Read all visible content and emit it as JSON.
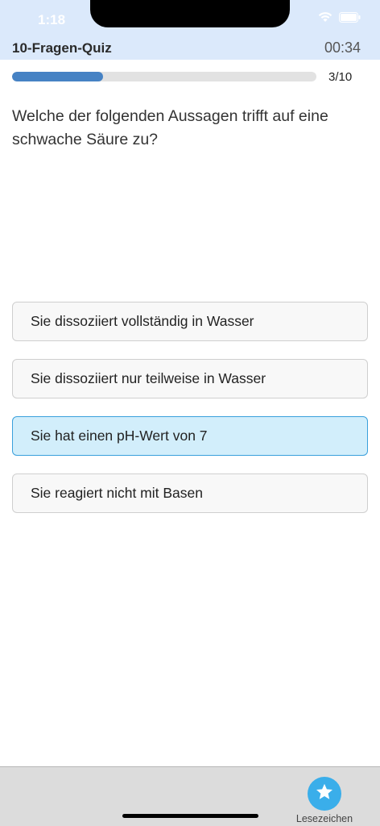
{
  "status_bar": {
    "time": "1:18",
    "icons": [
      "wifi-icon",
      "battery-icon"
    ]
  },
  "header": {
    "title": "10-Fragen-Quiz",
    "timer": "00:34"
  },
  "progress": {
    "fraction": 0.3,
    "label": "3/10"
  },
  "question": {
    "text": "Welche der folgenden Aussagen trifft auf eine schwache Säure zu?"
  },
  "answers": [
    {
      "label": "Sie dissoziiert vollständig in Wasser",
      "selected": false
    },
    {
      "label": "Sie dissoziiert nur teilweise in Wasser",
      "selected": false
    },
    {
      "label": "Sie hat einen pH-Wert von 7",
      "selected": true
    },
    {
      "label": "Sie reagiert nicht mit Basen",
      "selected": false
    }
  ],
  "tab_bar": {
    "bookmark_label": "Lesezeichen",
    "bookmark_icon": "star-icon"
  },
  "colors": {
    "header_bg": "#dbe9fb",
    "progress_fill": "#4682c4",
    "selected_bg": "#d2eefb",
    "selected_border": "#3aa0dc",
    "bookmark": "#3aaeea"
  }
}
